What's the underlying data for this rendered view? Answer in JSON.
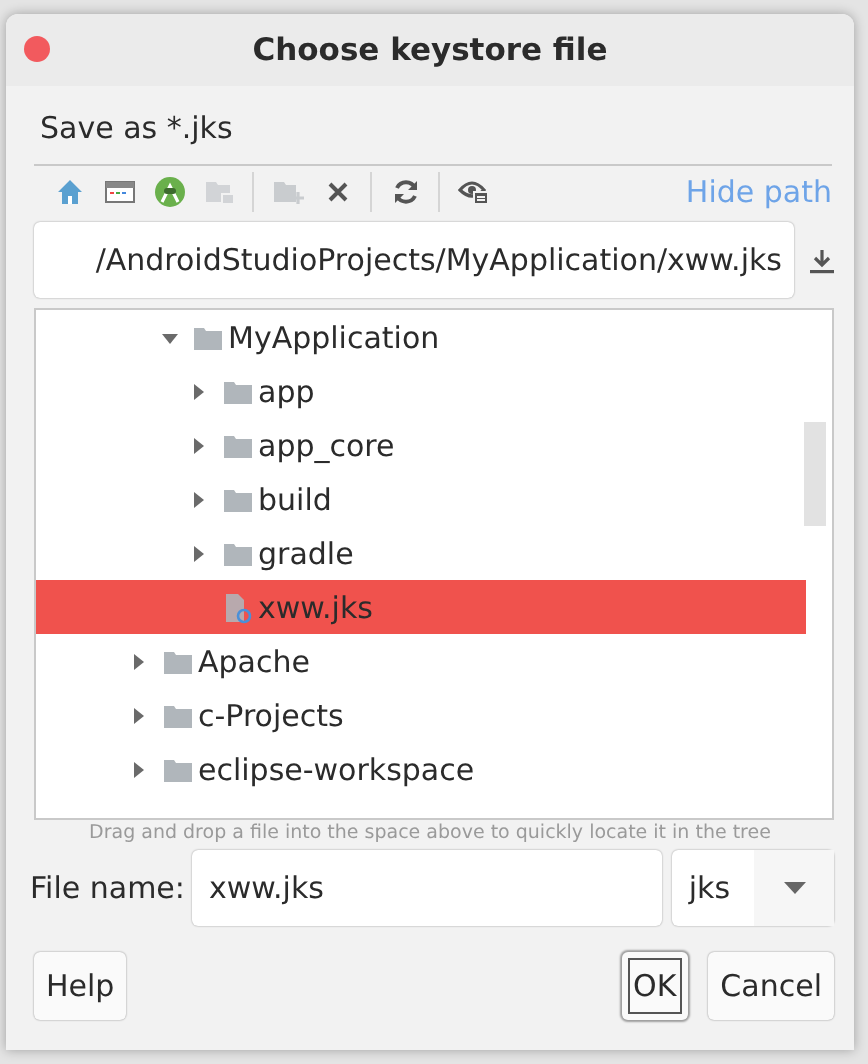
{
  "window": {
    "title": "Choose keystore file"
  },
  "description": "Save as *.jks",
  "toolbar": [
    {
      "kind": "home",
      "disabled": false
    },
    {
      "kind": "desktop",
      "disabled": false
    },
    {
      "kind": "android",
      "disabled": false
    },
    {
      "kind": "folder",
      "disabled": true
    },
    {
      "kind": "separator"
    },
    {
      "kind": "new-folder",
      "disabled": true
    },
    {
      "kind": "delete",
      "disabled": false
    },
    {
      "kind": "separator"
    },
    {
      "kind": "refresh",
      "disabled": false
    },
    {
      "kind": "separator"
    },
    {
      "kind": "show-hidden",
      "disabled": false
    }
  ],
  "hide_path_link": "Hide path",
  "path_field": {
    "value": "/AndroidStudioProjects/MyApplication/xww.jks"
  },
  "tree": {
    "items": [
      {
        "children": [
          {
            "kind": "folder",
            "label": "MyApplication",
            "expanded": true,
            "selected": false,
            "children": [
              {
                "kind": "folder",
                "label": "app",
                "expanded": false,
                "selected": false
              },
              {
                "kind": "folder",
                "label": "app_core",
                "expanded": false,
                "selected": false
              },
              {
                "kind": "folder",
                "label": "build",
                "expanded": false,
                "selected": false
              },
              {
                "kind": "folder",
                "label": "gradle",
                "expanded": false,
                "selected": false
              },
              {
                "kind": "file",
                "label": "xww.jks",
                "selected": true
              }
            ]
          }
        ]
      },
      {
        "kind": "folder",
        "label": "Apache",
        "expanded": false,
        "selected": false
      },
      {
        "kind": "folder",
        "label": "c-Projects",
        "expanded": false,
        "selected": false
      },
      {
        "kind": "folder",
        "label": "eclipse-workspace",
        "expanded": false,
        "selected": false
      }
    ]
  },
  "drop_hint": "Drag and drop a file into the space above to quickly locate it in the tree",
  "file_name": {
    "label": "File name:",
    "value": "xww.jks"
  },
  "file_type": {
    "value": "jks"
  },
  "buttons": [
    {
      "kind": "help",
      "label": "Help",
      "focused": false
    },
    {
      "kind": "ok",
      "label": "OK",
      "focused": true
    },
    {
      "kind": "cancel",
      "label": "Cancel",
      "focused": false
    }
  ]
}
